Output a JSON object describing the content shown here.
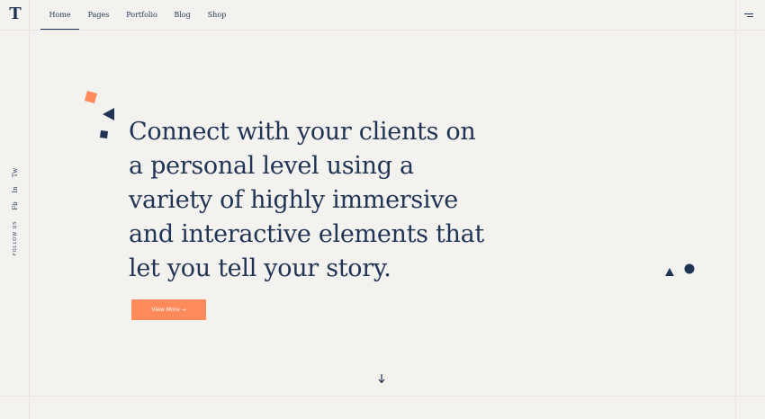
{
  "logo": {
    "letter": "T"
  },
  "nav": {
    "items": [
      {
        "label": "Home",
        "active": true
      },
      {
        "label": "Pages",
        "active": false
      },
      {
        "label": "Portfolio",
        "active": false
      },
      {
        "label": "Blog",
        "active": false
      },
      {
        "label": "Shop",
        "active": false
      }
    ]
  },
  "menu_icon": "hamburger-icon",
  "social": {
    "links": [
      "Tw",
      "In",
      "Fb"
    ],
    "follow_label": "FOLLOW US"
  },
  "hero": {
    "text": "Connect with your clients on\na personal level using a\nvariety of highly immersive\nand interactive elements that\nlet you tell your story.",
    "button_label": "View More →"
  },
  "scroll_icon": "arrow-down-icon",
  "colors": {
    "background": "#f4f2ef",
    "navy": "#1f3354",
    "accent": "#ff8a5c",
    "grid_line": "#e7e4df"
  }
}
